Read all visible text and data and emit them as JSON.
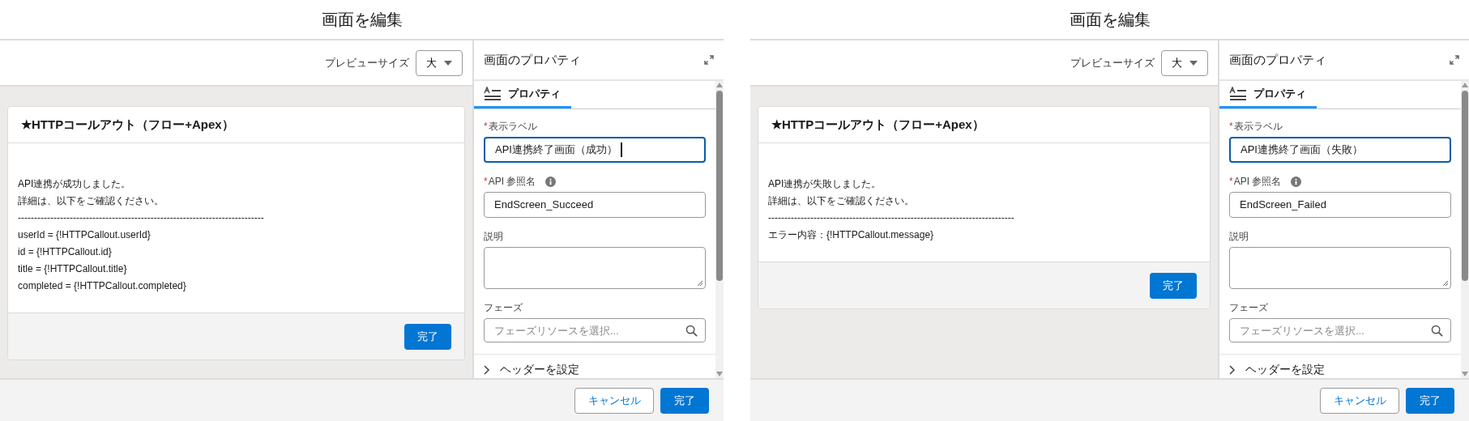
{
  "panels": [
    {
      "title": "画面を編集",
      "preview_size": {
        "label": "プレビューサイズ",
        "value": "大"
      },
      "screen": {
        "title": "★HTTPコールアウト（フロー+Apex）",
        "lines": [
          "API連携が成功しました。",
          "詳細は、以下をご確認ください。",
          "----------------------------------------------------------------------------",
          "userId = {!HTTPCallout.userId}",
          "id = {!HTTPCallout.id}",
          "title = {!HTTPCallout.title}",
          "completed = {!HTTPCallout.completed}"
        ],
        "button": "完了"
      },
      "properties": {
        "title": "画面のプロパティ",
        "tabs": [
          {
            "label": "プロパティ",
            "selected": true
          }
        ],
        "fields": [
          {
            "kind": "input",
            "label": "表示ラベル",
            "required_mark": "*",
            "value": "API連携終了画面（成功）",
            "focused": true,
            "cursor": true
          },
          {
            "kind": "input",
            "label": "API 参照名",
            "required_mark": "*",
            "info": true,
            "value": "EndScreen_Succeed",
            "focused": false,
            "cursor": false
          },
          {
            "kind": "textarea",
            "label": "説明"
          },
          {
            "kind": "search",
            "label": "フェーズ",
            "placeholder": "フェーズリソースを選択..."
          }
        ],
        "section": {
          "label": "ヘッダーを設定",
          "expanded": false
        }
      },
      "footer": {
        "cancel": "キャンセル",
        "done": "完了"
      }
    },
    {
      "title": "画面を編集",
      "preview_size": {
        "label": "プレビューサイズ",
        "value": "大"
      },
      "screen": {
        "title": "★HTTPコールアウト（フロー+Apex）",
        "lines": [
          "API連携が失敗しました。",
          "詳細は、以下をご確認ください。",
          "----------------------------------------------------------------------------",
          "エラー内容：{!HTTPCallout.message}"
        ],
        "button": "完了"
      },
      "properties": {
        "title": "画面のプロパティ",
        "tabs": [
          {
            "label": "プロパティ",
            "selected": true
          }
        ],
        "fields": [
          {
            "kind": "input",
            "label": "表示ラベル",
            "required_mark": "*",
            "value": "API連携終了画面（失敗）",
            "focused": true,
            "cursor": false
          },
          {
            "kind": "input",
            "label": "API 参照名",
            "required_mark": "*",
            "info": true,
            "value": "EndScreen_Failed",
            "focused": false,
            "cursor": false
          },
          {
            "kind": "textarea",
            "label": "説明"
          },
          {
            "kind": "search",
            "label": "フェーズ",
            "placeholder": "フェーズリソースを選択..."
          }
        ],
        "section": {
          "label": "ヘッダーを設定",
          "expanded": false
        }
      },
      "footer": {
        "cancel": "キャンセル",
        "done": "完了"
      }
    }
  ]
}
